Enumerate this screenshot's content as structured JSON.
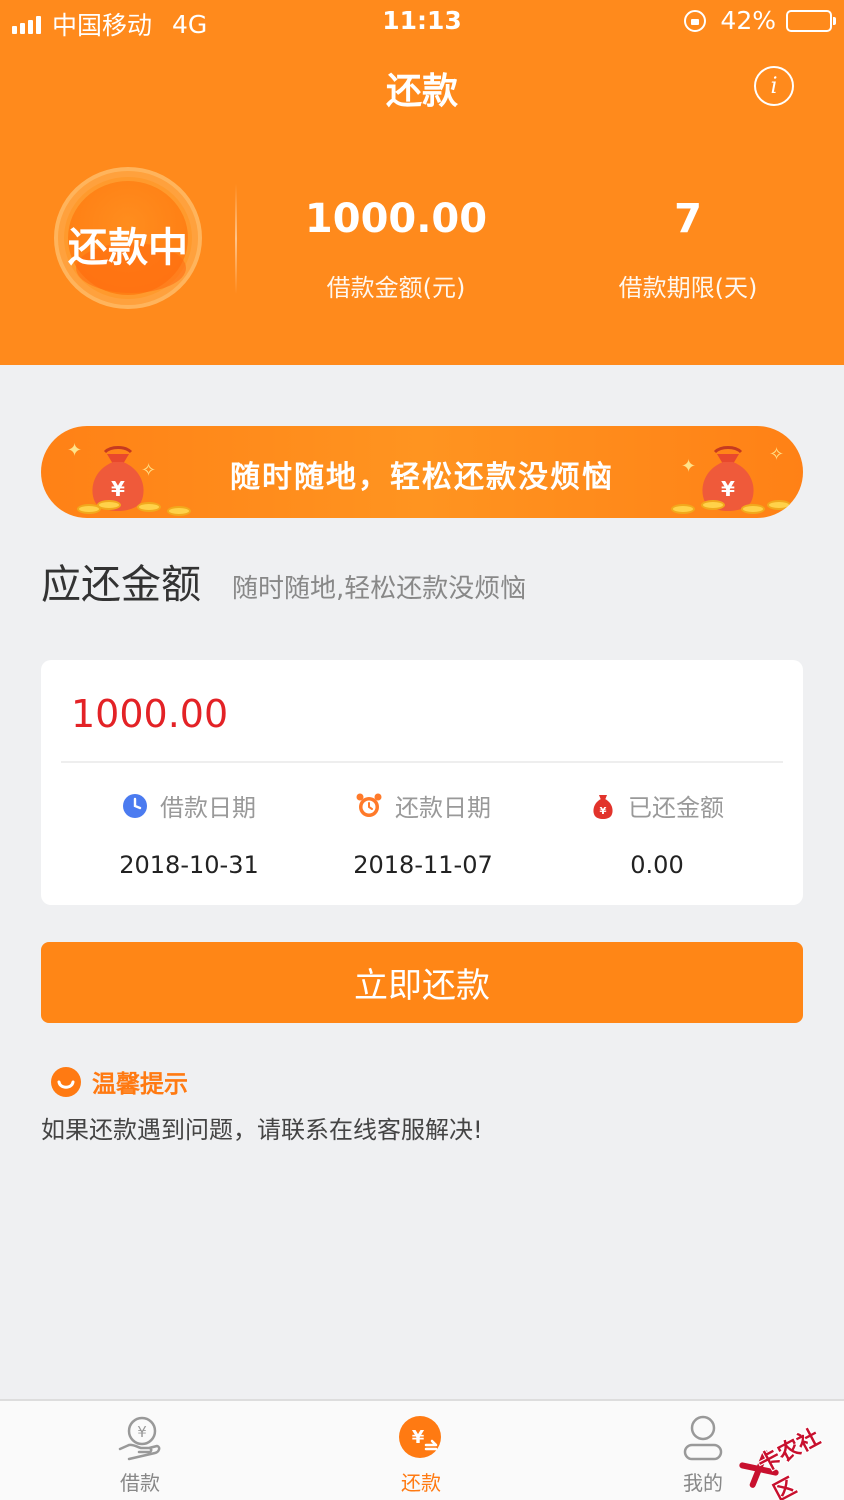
{
  "status_bar": {
    "carrier": "中国移动",
    "network": "4G",
    "time": "11:13",
    "battery": "42%",
    "battery_level": 0.42
  },
  "nav": {
    "title": "还款",
    "info_icon": "info-icon"
  },
  "summary": {
    "status_label": "还款中",
    "amount_value": "1000.00",
    "amount_label": "借款金额(元)",
    "term_value": "7",
    "term_label": "借款期限(天)"
  },
  "banner": {
    "text": "随时随地，轻松还款没烦恼",
    "icon": "money-bag-icon"
  },
  "due": {
    "title": "应还金额",
    "subtitle": "随时随地,轻松还款没烦恼",
    "amount": "1000.00",
    "columns": [
      {
        "label": "借款日期",
        "value": "2018-10-31",
        "icon": "clock-icon"
      },
      {
        "label": "还款日期",
        "value": "2018-11-07",
        "icon": "alarm-clock-icon"
      },
      {
        "label": "已还金额",
        "value": "0.00",
        "icon": "money-bag-icon"
      }
    ]
  },
  "actions": {
    "pay_label": "立即还款"
  },
  "tips": {
    "title": "温馨提示",
    "body": "如果还款遇到问题，请联系在线客服解决!"
  },
  "tabbar": {
    "items": [
      {
        "label": "借款",
        "icon": "borrow-icon",
        "active": false
      },
      {
        "label": "还款",
        "icon": "repay-icon",
        "active": true
      },
      {
        "label": "我的",
        "icon": "user-icon",
        "active": false
      }
    ]
  },
  "watermark": {
    "text": "卡农社区"
  },
  "colors": {
    "primary": "#ff8a1c",
    "button": "#ff8616",
    "amount_red": "#e32226",
    "tab_active": "#ff7a12",
    "background": "#eff0f2"
  }
}
